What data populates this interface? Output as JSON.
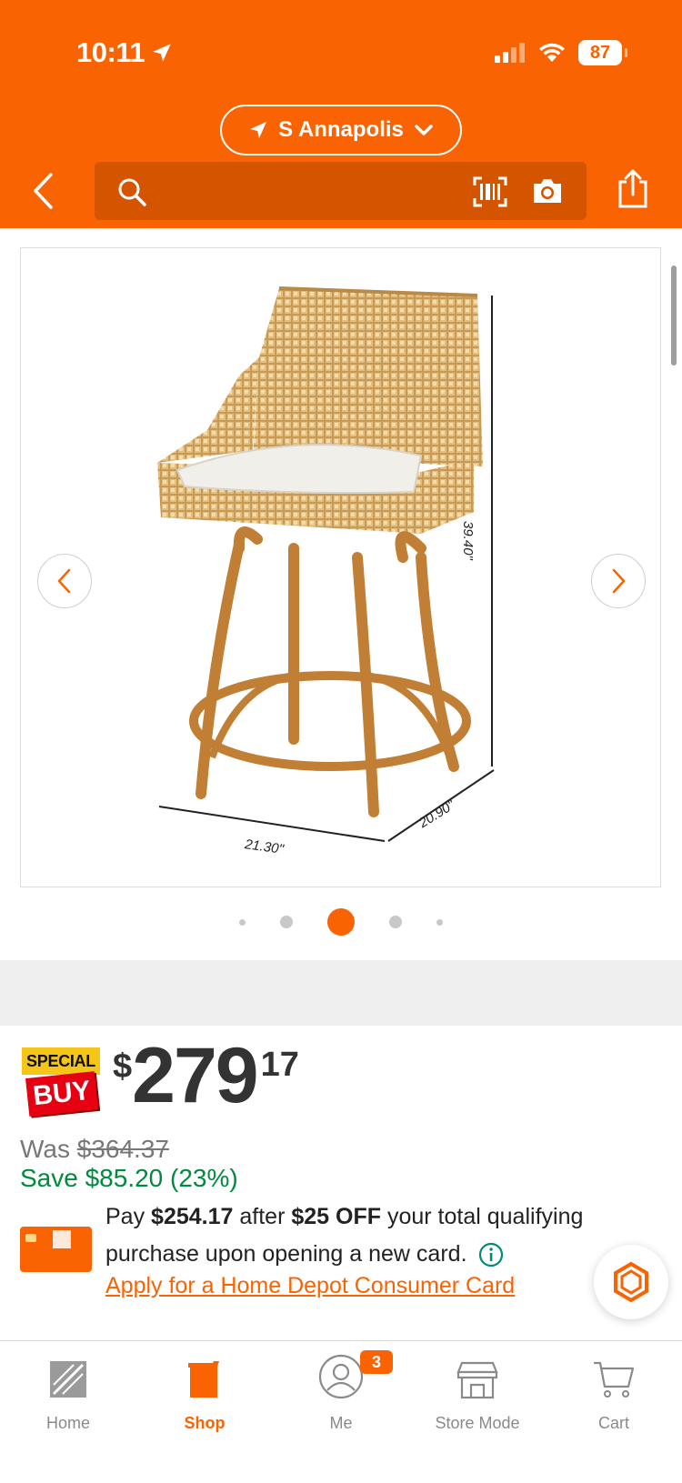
{
  "status_bar": {
    "time": "10:11",
    "battery": "87"
  },
  "header": {
    "store_name": "S Annapolis",
    "search_placeholder": ""
  },
  "gallery": {
    "dimension_height": "39.40\"",
    "dimension_width": "21.30\"",
    "dimension_depth": "20.90\"",
    "total_images": 5,
    "active_index": 2
  },
  "price": {
    "badge_top": "SPECIAL",
    "badge_bottom": "BUY",
    "currency": "$",
    "dollars": "279",
    "cents": "17",
    "was_label": "Was",
    "was_price": "$364.37",
    "save_text": "Save $85.20 (23%)"
  },
  "promo": {
    "pay_prefix": "Pay",
    "pay_amount": "$254.17",
    "after": "after",
    "discount": "$25 OFF",
    "rest": "your total qualifying purchase upon opening a new card.",
    "link": "Apply for a Home Depot Consumer Card"
  },
  "tabbar": {
    "tabs": [
      {
        "label": "Home",
        "icon": "home-depot-logo-icon"
      },
      {
        "label": "Shop",
        "icon": "paint-bucket-icon"
      },
      {
        "label": "Me",
        "icon": "user-icon"
      },
      {
        "label": "Store Mode",
        "icon": "store-icon"
      },
      {
        "label": "Cart",
        "icon": "cart-icon"
      }
    ],
    "me_badge": "3"
  },
  "colors": {
    "brand_orange": "#f96302",
    "save_green": "#008a3e",
    "special_yellow": "#f5c518",
    "special_red": "#e60012"
  }
}
